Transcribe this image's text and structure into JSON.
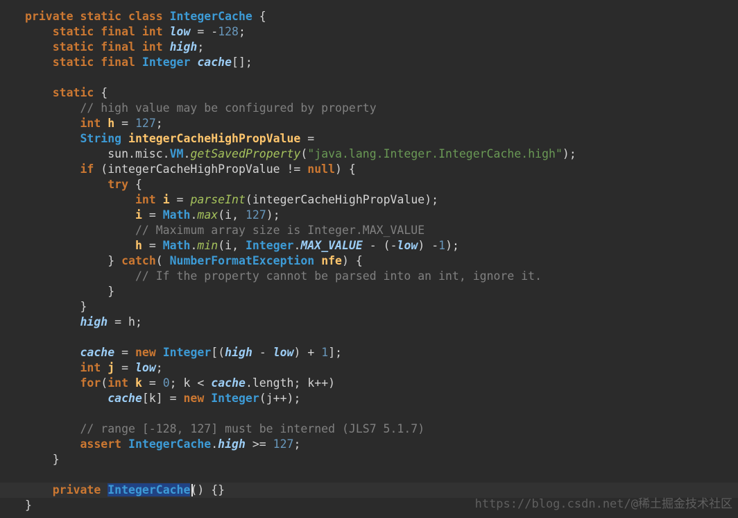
{
  "editor": {
    "lines": [
      [
        {
          "t": "private static class ",
          "c": "kw"
        },
        {
          "t": "IntegerCache",
          "c": "ty"
        },
        {
          "t": " {",
          "c": "pl"
        }
      ],
      [
        {
          "t": "    static final int ",
          "c": "kw"
        },
        {
          "t": "low",
          "c": "fld"
        },
        {
          "t": " = -",
          "c": "pl"
        },
        {
          "t": "128",
          "c": "num"
        },
        {
          "t": ";",
          "c": "pl"
        }
      ],
      [
        {
          "t": "    static final int ",
          "c": "kw"
        },
        {
          "t": "high",
          "c": "fld"
        },
        {
          "t": ";",
          "c": "pl"
        }
      ],
      [
        {
          "t": "    static final ",
          "c": "kw"
        },
        {
          "t": "Integer",
          "c": "ty"
        },
        {
          "t": " ",
          "c": "pl"
        },
        {
          "t": "cache",
          "c": "fld"
        },
        {
          "t": "[];",
          "c": "pl"
        }
      ],
      [],
      [
        {
          "t": "    static",
          "c": "kw"
        },
        {
          "t": " {",
          "c": "pl"
        }
      ],
      [
        {
          "t": "        // high value may be configured by property",
          "c": "cm"
        }
      ],
      [
        {
          "t": "        int ",
          "c": "kw"
        },
        {
          "t": "h",
          "c": "var"
        },
        {
          "t": " = ",
          "c": "pl"
        },
        {
          "t": "127",
          "c": "num"
        },
        {
          "t": ";",
          "c": "pl"
        }
      ],
      [
        {
          "t": "        String",
          "c": "ty"
        },
        {
          "t": " ",
          "c": "pl"
        },
        {
          "t": "integerCacheHighPropValue",
          "c": "var"
        },
        {
          "t": " =",
          "c": "pl"
        }
      ],
      [
        {
          "t": "            sun.misc.",
          "c": "pl"
        },
        {
          "t": "VM",
          "c": "ty"
        },
        {
          "t": ".",
          "c": "pl"
        },
        {
          "t": "getSavedProperty",
          "c": "fn"
        },
        {
          "t": "(",
          "c": "pl"
        },
        {
          "t": "\"java.lang.Integer.IntegerCache.high\"",
          "c": "str"
        },
        {
          "t": ");",
          "c": "pl"
        }
      ],
      [
        {
          "t": "        if",
          "c": "kw"
        },
        {
          "t": " (integerCacheHighPropValue != ",
          "c": "pl"
        },
        {
          "t": "null",
          "c": "kw"
        },
        {
          "t": ") {",
          "c": "pl"
        }
      ],
      [
        {
          "t": "            try",
          "c": "kw"
        },
        {
          "t": " {",
          "c": "pl"
        }
      ],
      [
        {
          "t": "                int ",
          "c": "kw"
        },
        {
          "t": "i",
          "c": "var"
        },
        {
          "t": " = ",
          "c": "pl"
        },
        {
          "t": "parseInt",
          "c": "fn"
        },
        {
          "t": "(integerCacheHighPropValue);",
          "c": "pl"
        }
      ],
      [
        {
          "t": "                i",
          "c": "var"
        },
        {
          "t": " = ",
          "c": "pl"
        },
        {
          "t": "Math",
          "c": "ty"
        },
        {
          "t": ".",
          "c": "pl"
        },
        {
          "t": "max",
          "c": "fn"
        },
        {
          "t": "(i, ",
          "c": "pl"
        },
        {
          "t": "127",
          "c": "num"
        },
        {
          "t": ");",
          "c": "pl"
        }
      ],
      [
        {
          "t": "                // Maximum array size is Integer.MAX_VALUE",
          "c": "cm"
        }
      ],
      [
        {
          "t": "                h",
          "c": "var"
        },
        {
          "t": " = ",
          "c": "pl"
        },
        {
          "t": "Math",
          "c": "ty"
        },
        {
          "t": ".",
          "c": "pl"
        },
        {
          "t": "min",
          "c": "fn"
        },
        {
          "t": "(i, ",
          "c": "pl"
        },
        {
          "t": "Integer",
          "c": "ty"
        },
        {
          "t": ".",
          "c": "pl"
        },
        {
          "t": "MAX_VALUE",
          "c": "fld"
        },
        {
          "t": " - (-",
          "c": "pl"
        },
        {
          "t": "low",
          "c": "fld"
        },
        {
          "t": ") -",
          "c": "pl"
        },
        {
          "t": "1",
          "c": "num"
        },
        {
          "t": ");",
          "c": "pl"
        }
      ],
      [
        {
          "t": "            } ",
          "c": "pl"
        },
        {
          "t": "catch",
          "c": "kw"
        },
        {
          "t": "( ",
          "c": "pl"
        },
        {
          "t": "NumberFormatException",
          "c": "ty"
        },
        {
          "t": " ",
          "c": "pl"
        },
        {
          "t": "nfe",
          "c": "var"
        },
        {
          "t": ") {",
          "c": "pl"
        }
      ],
      [
        {
          "t": "                // If the property cannot be parsed into an int, ignore it.",
          "c": "cm"
        }
      ],
      [
        {
          "t": "            }",
          "c": "pl"
        }
      ],
      [
        {
          "t": "        }",
          "c": "pl"
        }
      ],
      [
        {
          "t": "        ",
          "c": "pl"
        },
        {
          "t": "high",
          "c": "fld"
        },
        {
          "t": " = h;",
          "c": "pl"
        }
      ],
      [],
      [
        {
          "t": "        ",
          "c": "pl"
        },
        {
          "t": "cache",
          "c": "fld"
        },
        {
          "t": " = ",
          "c": "pl"
        },
        {
          "t": "new ",
          "c": "kw"
        },
        {
          "t": "Integer",
          "c": "ty"
        },
        {
          "t": "[(",
          "c": "pl"
        },
        {
          "t": "high",
          "c": "fld"
        },
        {
          "t": " - ",
          "c": "pl"
        },
        {
          "t": "low",
          "c": "fld"
        },
        {
          "t": ") + ",
          "c": "pl"
        },
        {
          "t": "1",
          "c": "num"
        },
        {
          "t": "];",
          "c": "pl"
        }
      ],
      [
        {
          "t": "        int ",
          "c": "kw"
        },
        {
          "t": "j",
          "c": "var"
        },
        {
          "t": " = ",
          "c": "pl"
        },
        {
          "t": "low",
          "c": "fld"
        },
        {
          "t": ";",
          "c": "pl"
        }
      ],
      [
        {
          "t": "        for",
          "c": "kw"
        },
        {
          "t": "(",
          "c": "pl"
        },
        {
          "t": "int ",
          "c": "kw"
        },
        {
          "t": "k",
          "c": "var"
        },
        {
          "t": " = ",
          "c": "pl"
        },
        {
          "t": "0",
          "c": "num"
        },
        {
          "t": "; k < ",
          "c": "pl"
        },
        {
          "t": "cache",
          "c": "fld"
        },
        {
          "t": ".length; k++)",
          "c": "pl"
        }
      ],
      [
        {
          "t": "            ",
          "c": "pl"
        },
        {
          "t": "cache",
          "c": "fld"
        },
        {
          "t": "[k] = ",
          "c": "pl"
        },
        {
          "t": "new ",
          "c": "kw"
        },
        {
          "t": "Integer",
          "c": "ty"
        },
        {
          "t": "(j++);",
          "c": "pl"
        }
      ],
      [],
      [
        {
          "t": "        // range [-128, 127] must be interned (JLS7 5.1.7)",
          "c": "cm"
        }
      ],
      [
        {
          "t": "        assert ",
          "c": "kw"
        },
        {
          "t": "IntegerCache",
          "c": "ty"
        },
        {
          "t": ".",
          "c": "pl"
        },
        {
          "t": "high",
          "c": "fld"
        },
        {
          "t": " >= ",
          "c": "pl"
        },
        {
          "t": "127",
          "c": "num"
        },
        {
          "t": ";",
          "c": "pl"
        }
      ],
      [
        {
          "t": "    }",
          "c": "pl"
        }
      ],
      [],
      [
        {
          "t": "    private ",
          "c": "kw"
        },
        {
          "t": "IntegerCache",
          "c": "ty",
          "sel": true
        },
        {
          "t": "() {}",
          "c": "pl"
        }
      ],
      [
        {
          "t": "}",
          "c": "pl"
        }
      ]
    ],
    "current_line_index": 31
  },
  "watermark": {
    "text": "https://blog.csdn.net/@稀土掘金技术社区"
  }
}
